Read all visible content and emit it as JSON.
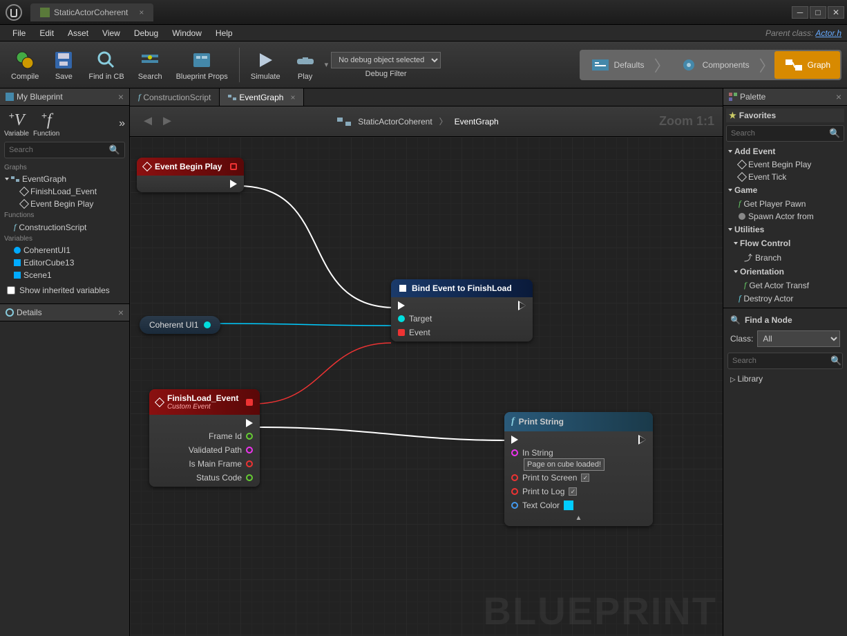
{
  "titlebar": {
    "title": "StaticActorCoherent"
  },
  "menu": {
    "items": [
      "File",
      "Edit",
      "Asset",
      "View",
      "Debug",
      "Window",
      "Help"
    ],
    "parent_label": "Parent class:",
    "parent_value": "Actor.h"
  },
  "toolbar": {
    "compile": "Compile",
    "save": "Save",
    "find": "Find in CB",
    "search": "Search",
    "props": "Blueprint Props",
    "simulate": "Simulate",
    "play": "Play",
    "debug_filter_label": "Debug Filter",
    "debug_select": "No debug object selected"
  },
  "nav": {
    "defaults": "Defaults",
    "components": "Components",
    "graph": "Graph"
  },
  "my_bp": {
    "tab": "My Blueprint",
    "variable": "Variable",
    "function": "Function",
    "search": "Search",
    "graphs_label": "Graphs",
    "event_graph": "EventGraph",
    "finishload_event": "FinishLoad_Event",
    "event_begin_play": "Event Begin Play",
    "functions_label": "Functions",
    "construction_script": "ConstructionScript",
    "variables_label": "Variables",
    "var1": "CoherentUI1",
    "var2": "EditorCube13",
    "var3": "Scene1",
    "show_inherited": "Show inherited variables"
  },
  "details": {
    "tab": "Details"
  },
  "center_tabs": {
    "construction": "ConstructionScript",
    "event_graph": "EventGraph"
  },
  "breadcrumb": {
    "root": "StaticActorCoherent",
    "leaf": "EventGraph"
  },
  "zoom": "Zoom 1:1",
  "nodes": {
    "begin_play": {
      "title": "Event Begin Play"
    },
    "coherent_var": {
      "label": "Coherent UI1"
    },
    "bind": {
      "title": "Bind Event to FinishLoad",
      "target": "Target",
      "event": "Event"
    },
    "finishload": {
      "title": "FinishLoad_Event",
      "subtitle": "Custom Event",
      "p1": "Frame Id",
      "p2": "Validated Path",
      "p3": "Is Main Frame",
      "p4": "Status Code"
    },
    "print": {
      "title": "Print String",
      "in_string": "In String",
      "value": "Page on cube loaded!",
      "screen": "Print to Screen",
      "log": "Print to Log",
      "color": "Text Color"
    }
  },
  "watermark": "BLUEPRINT",
  "palette": {
    "tab": "Palette",
    "favorites": "Favorites",
    "search": "Search",
    "add_event": "Add Event",
    "event_begin": "Event Begin Play",
    "event_tick": "Event Tick",
    "game": "Game",
    "get_pawn": "Get Player Pawn",
    "spawn": "Spawn Actor from",
    "utilities": "Utilities",
    "flow": "Flow Control",
    "branch": "Branch",
    "orientation": "Orientation",
    "get_transform": "Get Actor Transf",
    "destroy": "Destroy Actor"
  },
  "find_node": {
    "title": "Find a Node",
    "class_label": "Class:",
    "class_value": "All",
    "search": "Search",
    "library": "Library"
  }
}
